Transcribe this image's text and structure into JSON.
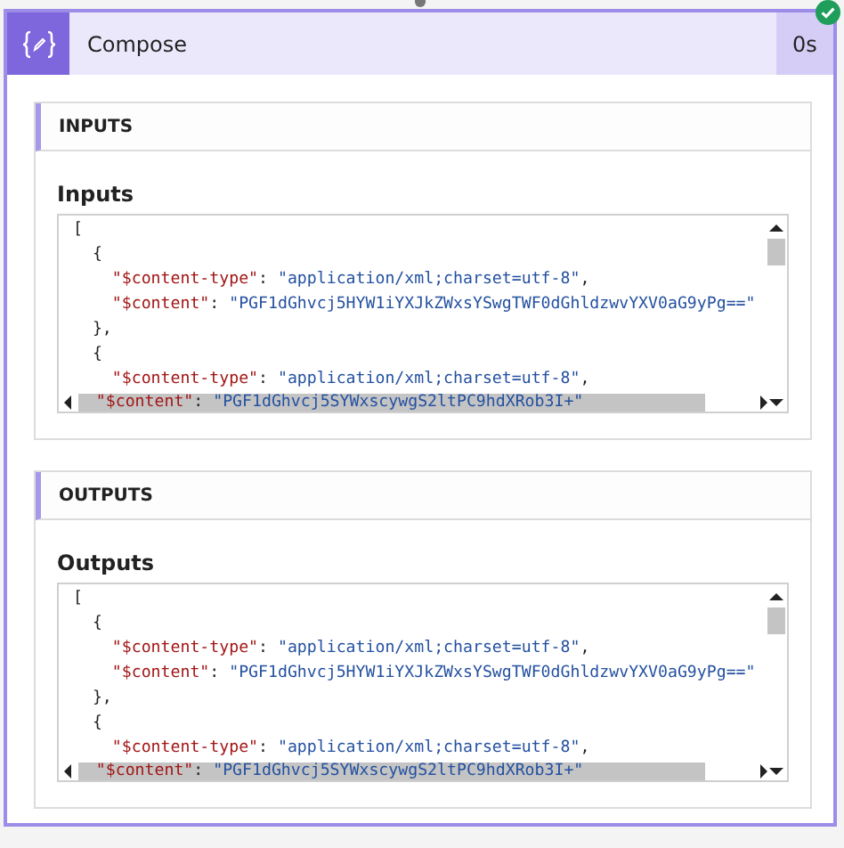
{
  "action": {
    "title": "Compose",
    "duration": "0s",
    "succeeded": true
  },
  "sections": [
    {
      "heading": "INPUTS",
      "label": "Inputs",
      "code": [
        {
          "open": "[",
          "children": [
            {
              "open": "{",
              "close": "},",
              "children": [
                {
                  "key": "\"$content-type\"",
                  "sep": ": ",
                  "value": "\"application/xml;charset=utf-8\"",
                  "end": ","
                },
                {
                  "key": "\"$content\"",
                  "sep": ": ",
                  "value": "\"PGF1dGhvcj5HYW1iYXJkZWxsYSwgTWF0dGhldzwvYXV0aG9yPg==\""
                }
              ]
            },
            {
              "open": "{",
              "children": [
                {
                  "key": "\"$content-type\"",
                  "sep": ": ",
                  "value": "\"application/xml;charset=utf-8\"",
                  "end": ","
                },
                {
                  "key": "\"$content\"",
                  "sep": ": ",
                  "value": "\"PGF1dGhvcj5SYWxscywgS2ltPC9hdXRob3I+\""
                }
              ]
            }
          ]
        }
      ]
    },
    {
      "heading": "OUTPUTS",
      "label": "Outputs",
      "code": [
        {
          "open": "[",
          "children": [
            {
              "open": "{",
              "close": "},",
              "children": [
                {
                  "key": "\"$content-type\"",
                  "sep": ": ",
                  "value": "\"application/xml;charset=utf-8\"",
                  "end": ","
                },
                {
                  "key": "\"$content\"",
                  "sep": ": ",
                  "value": "\"PGF1dGhvcj5HYW1iYXJkZWxsYSwgTWF0dGhldzwvYXV0aG9yPg==\""
                }
              ]
            },
            {
              "open": "{",
              "children": [
                {
                  "key": "\"$content-type\"",
                  "sep": ": ",
                  "value": "\"application/xml;charset=utf-8\"",
                  "end": ","
                },
                {
                  "key": "\"$content\"",
                  "sep": ": ",
                  "value": "\"PGF1dGhvcj5SYWxscywgS2ltPC9hdXRob3I+\""
                }
              ]
            }
          ]
        }
      ]
    }
  ]
}
